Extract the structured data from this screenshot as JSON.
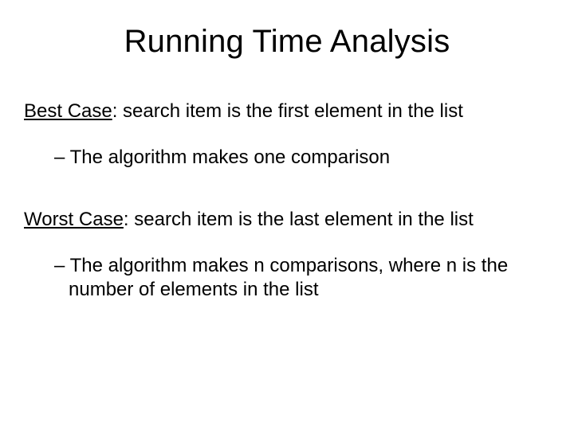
{
  "title": "Running Time Analysis",
  "best": {
    "label": "Best Case",
    "text": ": search item is the first element in the list",
    "sub_dash": "– ",
    "sub": "The algorithm makes one comparison"
  },
  "worst": {
    "label": "Worst Case",
    "text": ": search item is the last element in the list",
    "sub_dash": "– ",
    "sub": "The algorithm makes n comparisons, where n is the number of elements in the list"
  }
}
